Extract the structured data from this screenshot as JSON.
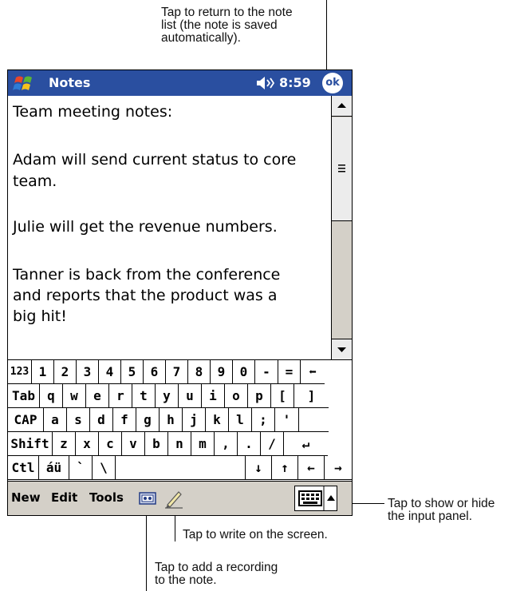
{
  "callouts": {
    "ok": [
      "Tap to return to the note",
      "list (the note is saved",
      "automatically)."
    ],
    "sip": [
      "Tap to show or hide",
      "the input panel."
    ],
    "pen": "Tap to write on the screen.",
    "recording": [
      "Tap to add a recording",
      "to the note."
    ]
  },
  "titlebar": {
    "app_title": "Notes",
    "time": "8:59",
    "ok_label": "ok",
    "icons": [
      "windows-start-icon",
      "speaker-icon"
    ]
  },
  "note": {
    "lines": [
      "Team meeting notes:",
      "",
      "Adam will send current status to core",
      "team.",
      "",
      "Julie will get the revenue numbers.",
      "",
      "Tanner is back from the conference",
      "and reports that the product was a",
      "big hit!"
    ]
  },
  "keyboard": {
    "row1": [
      "123",
      "1",
      "2",
      "3",
      "4",
      "5",
      "6",
      "7",
      "8",
      "9",
      "0",
      "-",
      "=",
      "⬅"
    ],
    "row2": [
      "Tab",
      "q",
      "w",
      "e",
      "r",
      "t",
      "y",
      "u",
      "i",
      "o",
      "p",
      "[",
      "]"
    ],
    "row3": [
      "CAP",
      "a",
      "s",
      "d",
      "f",
      "g",
      "h",
      "j",
      "k",
      "l",
      ";",
      "'"
    ],
    "row4": [
      "Shift",
      "z",
      "x",
      "c",
      "v",
      "b",
      "n",
      "m",
      ",",
      ".",
      "/",
      "↵"
    ],
    "row5": [
      "Ctl",
      "áü",
      "`",
      "\\",
      "",
      "↓",
      "↑",
      "←",
      "→"
    ]
  },
  "menubar": {
    "new": "New",
    "edit": "Edit",
    "tools": "Tools",
    "icons": [
      "recording-icon",
      "pen-icon",
      "keyboard-icon",
      "sip-arrow-up-icon"
    ]
  }
}
